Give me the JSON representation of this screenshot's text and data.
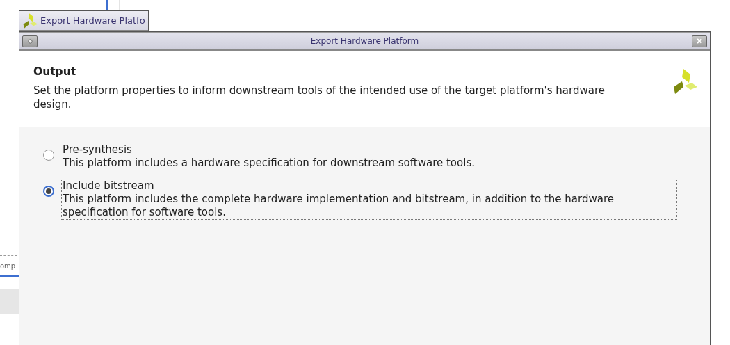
{
  "background": {
    "tab_label": "omp"
  },
  "taskbar_tab": {
    "label": "Export Hardware Platfo"
  },
  "dialog": {
    "title": "Export Hardware Platform",
    "header": {
      "title": "Output",
      "description": "Set the platform properties to inform downstream tools of the intended use of the target platform's hardware design."
    },
    "options": [
      {
        "label": "Pre-synthesis",
        "description": "This platform includes a hardware specification for downstream software tools.",
        "selected": false,
        "focused": false
      },
      {
        "label": "Include bitstream",
        "description": "This platform includes the complete hardware implementation and bitstream, in addition to the hardware specification for software tools.",
        "selected": true,
        "focused": true
      }
    ]
  }
}
